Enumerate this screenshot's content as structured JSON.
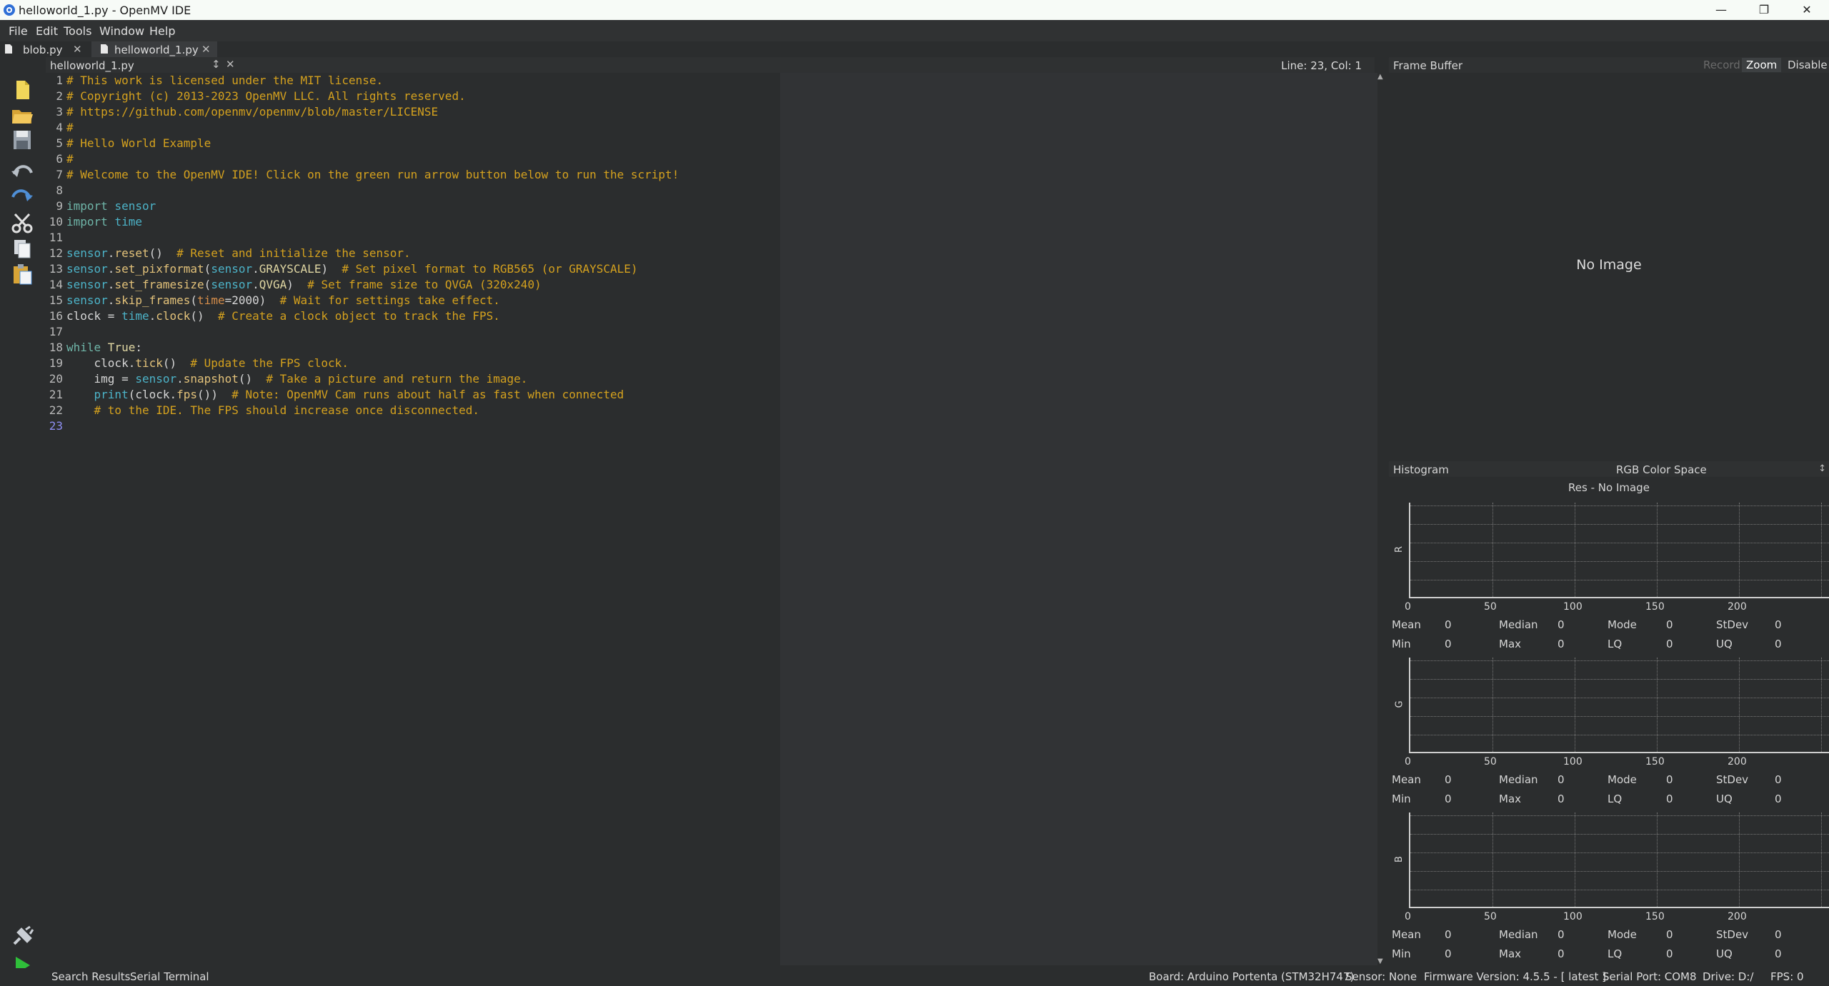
{
  "window": {
    "title": "helloworld_1.py - OpenMV IDE"
  },
  "menu": {
    "file": "File",
    "edit": "Edit",
    "tools": "Tools",
    "window": "Window",
    "help": "Help"
  },
  "tabs": [
    {
      "label": "blob.py"
    },
    {
      "label": "helloworld_1.py"
    }
  ],
  "editor": {
    "file_label": "helloworld_1.py",
    "cursor": "Line: 23, Col: 1",
    "lines": [
      [
        [
          "c",
          "# This work is licensed under the MIT license."
        ]
      ],
      [
        [
          "c",
          "# Copyright (c) 2013-2023 OpenMV LLC. All rights reserved."
        ]
      ],
      [
        [
          "c",
          "# https://github.com/openmv/openmv/blob/master/LICENSE"
        ]
      ],
      [
        [
          "c",
          "#"
        ]
      ],
      [
        [
          "c",
          "# Hello World Example"
        ]
      ],
      [
        [
          "c",
          "#"
        ]
      ],
      [
        [
          "c",
          "# Welcome to the OpenMV IDE! Click on the green run arrow button below to run the script!"
        ]
      ],
      [],
      [
        [
          "k",
          "import "
        ],
        [
          "m",
          "sensor"
        ]
      ],
      [
        [
          "k",
          "import "
        ],
        [
          "m",
          "time"
        ]
      ],
      [],
      [
        [
          "m",
          "sensor"
        ],
        [
          "p",
          "."
        ],
        [
          "f",
          "reset"
        ],
        [
          "p",
          "()  "
        ],
        [
          "c",
          "# Reset and initialize the sensor."
        ]
      ],
      [
        [
          "m",
          "sensor"
        ],
        [
          "p",
          "."
        ],
        [
          "f",
          "set_pixformat"
        ],
        [
          "p",
          "("
        ],
        [
          "m",
          "sensor"
        ],
        [
          "p",
          "."
        ],
        [
          "n",
          "GRAYSCALE"
        ],
        [
          "p",
          ")  "
        ],
        [
          "c",
          "# Set pixel format to RGB565 (or GRAYSCALE)"
        ]
      ],
      [
        [
          "m",
          "sensor"
        ],
        [
          "p",
          "."
        ],
        [
          "f",
          "set_framesize"
        ],
        [
          "p",
          "("
        ],
        [
          "m",
          "sensor"
        ],
        [
          "p",
          "."
        ],
        [
          "n",
          "QVGA"
        ],
        [
          "p",
          ")  "
        ],
        [
          "c",
          "# Set frame size to QVGA (320x240)"
        ]
      ],
      [
        [
          "m",
          "sensor"
        ],
        [
          "p",
          "."
        ],
        [
          "f",
          "skip_frames"
        ],
        [
          "p",
          "("
        ],
        [
          "a",
          "time"
        ],
        [
          "p",
          "=2000)  "
        ],
        [
          "c",
          "# Wait for settings take effect."
        ]
      ],
      [
        [
          "p",
          "clock = "
        ],
        [
          "m",
          "time"
        ],
        [
          "p",
          "."
        ],
        [
          "f",
          "clock"
        ],
        [
          "p",
          "()  "
        ],
        [
          "c",
          "# Create a clock object to track the FPS."
        ]
      ],
      [],
      [
        [
          "k",
          "while "
        ],
        [
          "n",
          "True"
        ],
        [
          "p",
          ":"
        ]
      ],
      [
        [
          "p",
          "    clock."
        ],
        [
          "f",
          "tick"
        ],
        [
          "p",
          "()  "
        ],
        [
          "c",
          "# Update the FPS clock."
        ]
      ],
      [
        [
          "p",
          "    img = "
        ],
        [
          "m",
          "sensor"
        ],
        [
          "p",
          "."
        ],
        [
          "f",
          "snapshot"
        ],
        [
          "p",
          "()  "
        ],
        [
          "c",
          "# Take a picture and return the image."
        ]
      ],
      [
        [
          "p",
          "    "
        ],
        [
          "m",
          "print"
        ],
        [
          "p",
          "(clock."
        ],
        [
          "f",
          "fps"
        ],
        [
          "p",
          "())  "
        ],
        [
          "c",
          "# Note: OpenMV Cam runs about half as fast when connected"
        ]
      ],
      [
        [
          "p",
          "    "
        ],
        [
          "c",
          "# to the IDE. The FPS should increase once disconnected."
        ]
      ],
      []
    ]
  },
  "frame_buffer": {
    "title": "Frame Buffer",
    "record": "Record",
    "zoom": "Zoom",
    "disable": "Disable",
    "no_image": "No Image"
  },
  "histogram": {
    "title": "Histogram",
    "color_space": "RGB Color Space",
    "res": "Res - No Image",
    "ticks": [
      "0",
      "50",
      "100",
      "150",
      "200"
    ],
    "channels": [
      {
        "name": "R",
        "mean": "0",
        "median": "0",
        "mode": "0",
        "stdev": "0",
        "min": "0",
        "max": "0",
        "lq": "0",
        "uq": "0"
      },
      {
        "name": "G",
        "mean": "0",
        "median": "0",
        "mode": "0",
        "stdev": "0",
        "min": "0",
        "max": "0",
        "lq": "0",
        "uq": "0"
      },
      {
        "name": "B",
        "mean": "0",
        "median": "0",
        "mode": "0",
        "stdev": "0",
        "min": "0",
        "max": "0",
        "lq": "0",
        "uq": "0"
      }
    ],
    "labels": {
      "mean": "Mean",
      "median": "Median",
      "mode": "Mode",
      "stdev": "StDev",
      "min": "Min",
      "max": "Max",
      "lq": "LQ",
      "uq": "UQ"
    }
  },
  "status": {
    "search_results": "Search Results",
    "serial_terminal": "Serial Terminal",
    "board": "Board: Arduino Portenta (STM32H747)",
    "sensor": "Sensor: None",
    "firmware": "Firmware Version: 4.5.5 - [ latest ]",
    "serial_port": "Serial Port: COM8",
    "drive": "Drive: D:/",
    "fps": "FPS: 0"
  }
}
